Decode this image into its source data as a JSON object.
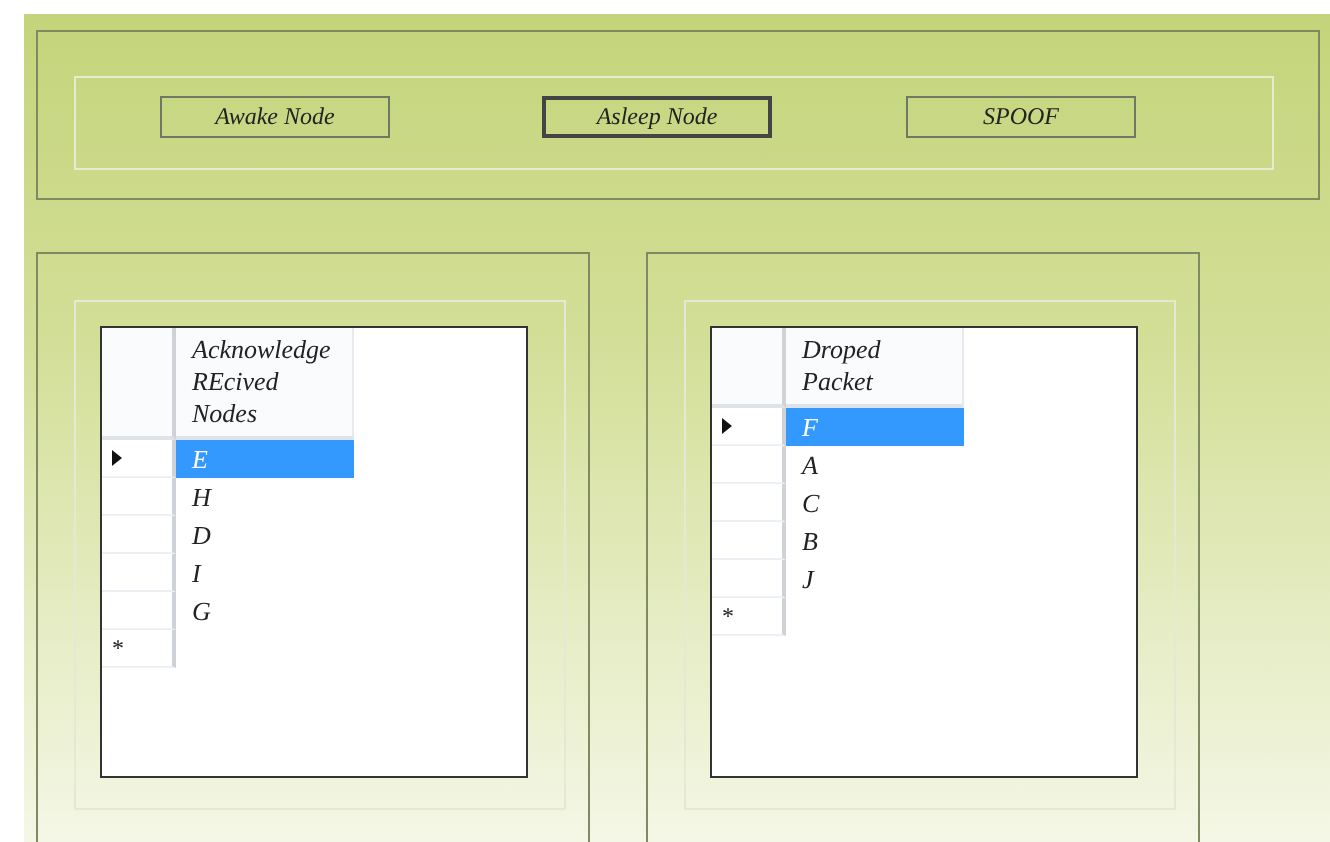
{
  "buttons": [
    {
      "label": "Awake Node",
      "focused": false
    },
    {
      "label": "Asleep Node",
      "focused": true
    },
    {
      "label": "SPOOF",
      "focused": false
    }
  ],
  "grids": [
    {
      "column": "Acknowledge REcived Nodes",
      "rows": [
        {
          "value": "E",
          "selected": true
        },
        {
          "value": "H",
          "selected": false
        },
        {
          "value": "D",
          "selected": false
        },
        {
          "value": "I",
          "selected": false
        },
        {
          "value": "G",
          "selected": false
        }
      ],
      "new_row_marker": "*"
    },
    {
      "column": "Droped Packet",
      "rows": [
        {
          "value": "F",
          "selected": true
        },
        {
          "value": "A",
          "selected": false
        },
        {
          "value": "C",
          "selected": false
        },
        {
          "value": "B",
          "selected": false
        },
        {
          "value": "J",
          "selected": false
        }
      ],
      "new_row_marker": "*"
    }
  ]
}
